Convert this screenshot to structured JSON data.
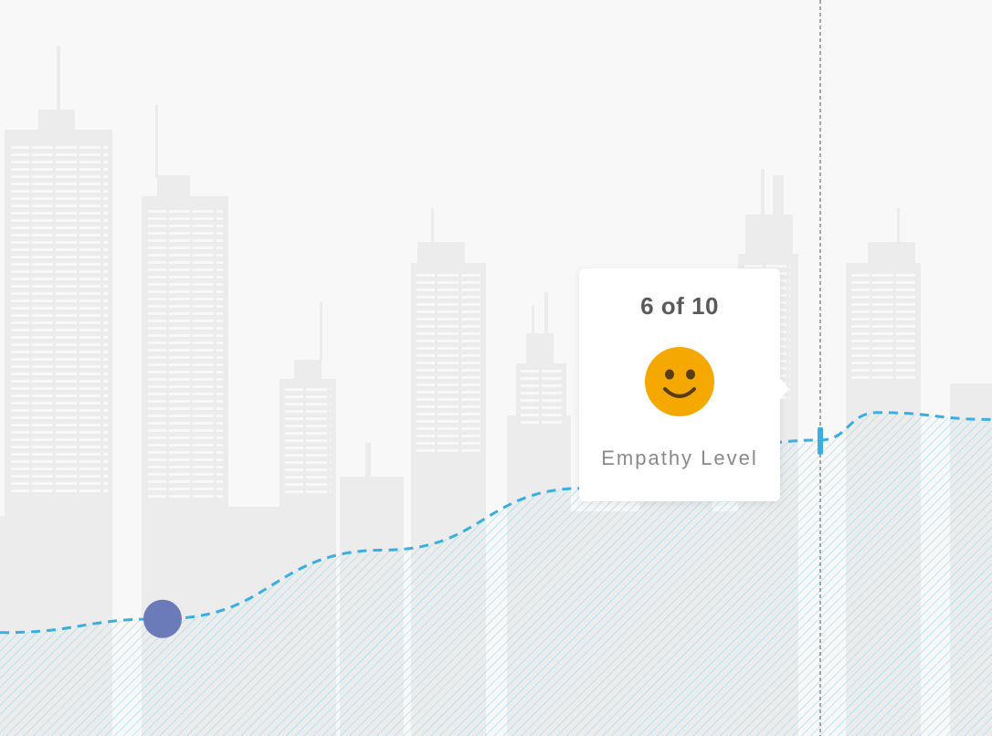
{
  "chart_data": {
    "type": "area",
    "series": [
      {
        "values": [
          5.4,
          5.5,
          6.0,
          6.45,
          6.8,
          7.0,
          6.95
        ]
      }
    ],
    "highlighted_point_index": 1,
    "cursor_index": 5,
    "ylim": [
      0,
      10
    ],
    "colors": {
      "line": "#3aaee0",
      "fill_hatch": "#9fdcef",
      "marker": "#6b7ab8",
      "cursor": "#555555",
      "city": "#e8e8e8",
      "smiley": "#f5a800"
    }
  },
  "tooltip": {
    "value_text": "6 of 10",
    "icon": "smiley-face-icon",
    "label": "Empathy Level"
  }
}
